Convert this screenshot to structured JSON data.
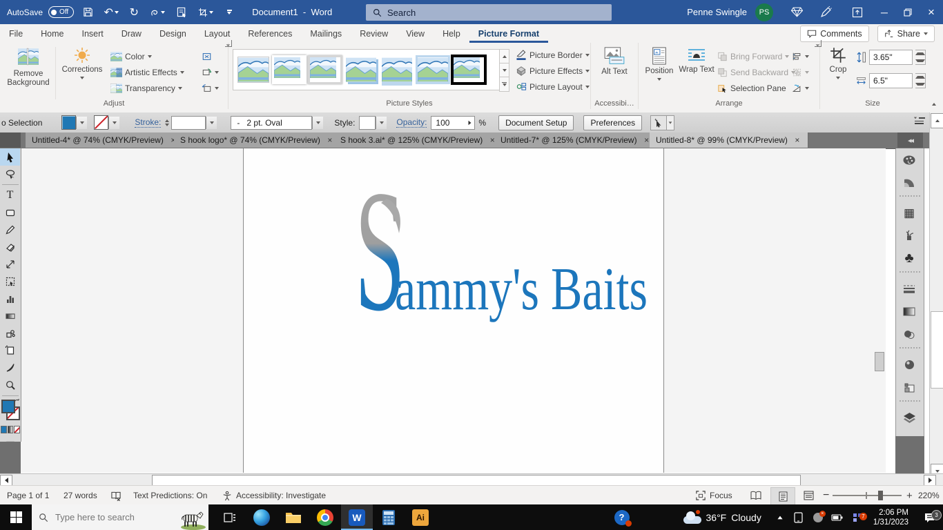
{
  "title_bar": {
    "autosave_label": "AutoSave",
    "autosave_state": "Off",
    "document_title": "Document1  -  Word",
    "search_text": "Search",
    "user_name": "Penne Swingle",
    "user_initials": "PS"
  },
  "ribbon_tabs": [
    "File",
    "Home",
    "Insert",
    "Draw",
    "Design",
    "Layout",
    "References",
    "Mailings",
    "Review",
    "View",
    "Help",
    "Picture Format"
  ],
  "active_tab": "Picture Format",
  "top_actions": {
    "comments": "Comments",
    "share": "Share"
  },
  "ribbon": {
    "adjust": {
      "remove_background": "Remove Background",
      "corrections": "Corrections",
      "color": "Color",
      "artistic_effects": "Artistic Effects",
      "transparency": "Transparency",
      "label": "Adjust"
    },
    "picture_styles": {
      "label": "Picture Styles",
      "picture_border": "Picture Border",
      "picture_effects": "Picture Effects",
      "picture_layout": "Picture Layout"
    },
    "accessibility": {
      "alt_text": "Alt Text",
      "label": "Accessibi…"
    },
    "arrange": {
      "position": "Position",
      "wrap_text": "Wrap Text",
      "bring_forward": "Bring Forward",
      "send_backward": "Send Backward",
      "selection_pane": "Selection Pane",
      "label": "Arrange"
    },
    "size": {
      "crop": "Crop",
      "height_value": "3.65\"",
      "width_value": "6.5\"",
      "label": "Size"
    }
  },
  "ai_control": {
    "selection_label": "o Selection",
    "stroke_label": "Stroke:",
    "brush_prefix": "-",
    "brush_value": "2 pt. Oval",
    "style_label": "Style:",
    "opacity_label": "Opacity:",
    "opacity_value": "100",
    "percent_label": "%",
    "document_setup": "Document Setup",
    "preferences": "Preferences"
  },
  "ai_tabs": [
    {
      "title": "Untitled-4* @ 74% (CMYK/Preview)"
    },
    {
      "title": "S hook logo* @ 74% (CMYK/Preview)"
    },
    {
      "title": "S hook 3.ai* @ 125% (CMYK/Preview)"
    },
    {
      "title": "Untitled-7* @ 125% (CMYK/Preview)"
    },
    {
      "title": "Untitled-8* @ 99% (CMYK/Preview)"
    }
  ],
  "canvas": {
    "logo_s": "S",
    "logo_rest": "ammy's Baits",
    "logo_blue": "#1c76bc",
    "hook_gray": "#a9a9a9"
  },
  "status_bar": {
    "page": "Page 1 of 1",
    "words": "27 words",
    "text_predictions": "Text Predictions: On",
    "accessibility": "Accessibility: Investigate",
    "focus": "Focus",
    "zoom_level": "220%"
  },
  "taskbar": {
    "search_placeholder": "Type here to search",
    "weather_temp": "36°F",
    "weather_condition": "Cloudy",
    "time": "2:06 PM",
    "date": "1/31/2023",
    "notification_count": "3",
    "badge_seven": "7",
    "word_icon_letter": "W",
    "illustrator_icon_letter": "Ai"
  }
}
